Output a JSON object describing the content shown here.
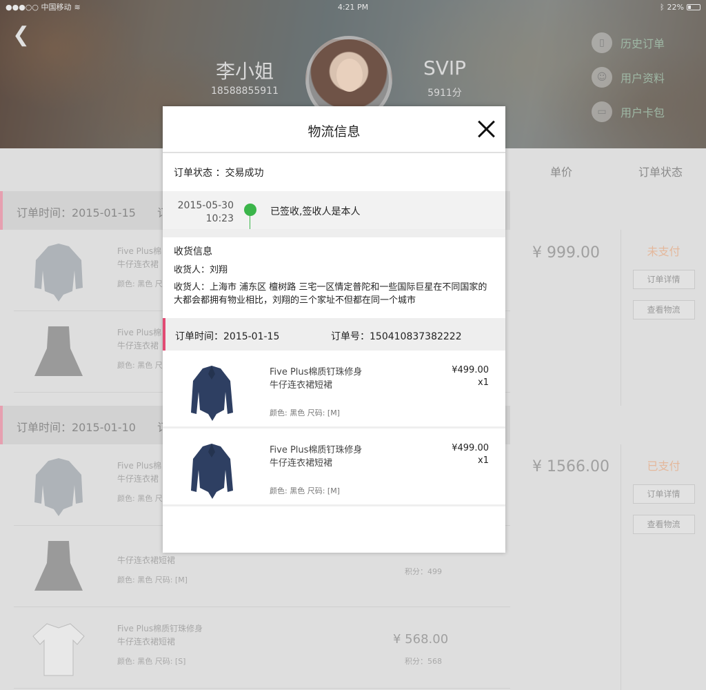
{
  "status_bar": {
    "carrier": "●●●○○ 中国移动",
    "time": "4:21 PM",
    "battery": "22%"
  },
  "profile": {
    "name": "李小姐",
    "phone": "18588855911",
    "level": "SVIP",
    "points": "5911分"
  },
  "side_menu": [
    {
      "label": "历史订单",
      "icon": "document-icon"
    },
    {
      "label": "用户资料",
      "icon": "user-icon"
    },
    {
      "label": "用户卡包",
      "icon": "wallet-icon"
    }
  ],
  "table_header": {
    "unit_price": "单价",
    "order_status": "订单状态"
  },
  "background_orders": [
    {
      "time_label": "订单时间：2015-01-15",
      "extra": "订",
      "items": [
        {
          "title": "Five Plus棉",
          "subtitle": "牛仔连衣裙",
          "spec": "颜色: 黑色  尺"
        },
        {
          "title": "Five Plus棉",
          "subtitle": "牛仔连衣裙",
          "spec": "颜色: 黑色  尺"
        }
      ],
      "total": "¥ 999.00",
      "status": "未支付",
      "btn_detail": "订单详情",
      "btn_logistics": "查看物流"
    },
    {
      "time_label": "订单时间：2015-01-10",
      "extra": "订",
      "items": [
        {
          "title": "Five Plus棉",
          "subtitle": "牛仔连衣裙",
          "spec": "颜色: 黑色  尺"
        },
        {
          "title": "",
          "subtitle": "牛仔连衣裙短裙",
          "spec": "颜色: 黑色  尺码: [M]",
          "points": "积分：499"
        },
        {
          "title": "Five Plus棉质钉珠修身",
          "subtitle": "牛仔连衣裙短裙",
          "spec": "颜色: 黑色  尺码: [S]",
          "price": "¥ 568.00",
          "points": "积分：568"
        }
      ],
      "total": "¥ 1566.00",
      "status": "已支付",
      "btn_detail": "订单详情",
      "btn_logistics": "查看物流"
    }
  ],
  "modal": {
    "title": "物流信息",
    "order_status": "订单状态  ：交易成功",
    "tracking": {
      "date": "2015-05-30",
      "time": "10:23",
      "text": "已签收,签收人是本人"
    },
    "shipping": {
      "title": "收货信息",
      "receiver": "收货人：刘翔",
      "address": "收货人：上海市 浦东区 檀树路 三宅一区情定普陀和一些国际巨星在不同国家的大都会都拥有物业相比，刘翔的三个家址不但都在同一个城市"
    },
    "order": {
      "time": "订单时间：2015-01-15",
      "number": "订单号：150410837382222"
    },
    "items": [
      {
        "title": "Five Plus棉质钉珠修身",
        "subtitle": "牛仔连衣裙短裙",
        "spec": "颜色: 黑色   尺码: [M]",
        "price": "¥499.00",
        "qty": "x1"
      },
      {
        "title": "Five Plus棉质钉珠修身",
        "subtitle": "牛仔连衣裙短裙",
        "spec": "颜色: 黑色   尺码: [M]",
        "price": "¥499.00",
        "qty": "x1"
      }
    ]
  },
  "colors": {
    "accent_green": "#3bb54a",
    "accent_pink": "#e24a73",
    "unpaid": "#e4b89c"
  }
}
